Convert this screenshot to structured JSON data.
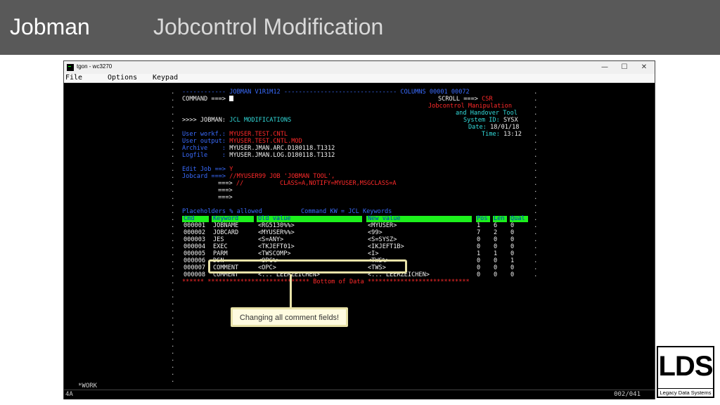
{
  "slide": {
    "title": "Jobman",
    "subtitle": "Jobcontrol Modification"
  },
  "window": {
    "title": "tgon - wc3270",
    "minimize": "—",
    "maximize": "☐",
    "close": "✕"
  },
  "menu": {
    "file": "File",
    "options": "Options",
    "keypad": "Keypad"
  },
  "terminal": {
    "line1_left": "------------ JOBMAN V1R1M12 ------------------------------- COLUMNS 00001 00072",
    "command_label": "COMMAND ===>",
    "scroll_label": "SCROLL ===>",
    "scroll_value": "CSR",
    "tagline1": "Jobcontrol Manipulation",
    "tagline2": "and Handover Tool",
    "system_label": "System ID:",
    "system_value": "SYSX",
    "prompt": ">>>> JOBMAN:",
    "prompt_title": "JCL MODIFICATIONS",
    "date_label": "Date:",
    "date_value": "18/01/18",
    "time_label": "Time:",
    "time_value": "13:12",
    "workf_label": "User workf.:",
    "workf_value": "MYUSER.TEST.CNTL",
    "output_label": "User output:",
    "output_value": "MYUSER.TEST.CNTL.MOD",
    "archive_label": "Archive    :",
    "archive_value": "MYUSER.JMAN.ARC.D180118.T1312",
    "logfile_label": "Logfile    :",
    "logfile_value": "MYUSER.JMAN.LOG.D180118.T1312",
    "editjob_label": "Edit Job ==>",
    "editjob_value": "Y",
    "jobcard_label": "Jobcard ===>",
    "jobcard_value1": "//MYUSER99 JOB 'JOBMAN TOOL',",
    "jobcard_cont": "===>",
    "jobcard_value2": "//          CLASS=A,NOTIFY=MYUSER,MSGCLASS=A",
    "jobcard_cont3": "===>",
    "jobcard_cont4": "===>",
    "placeholders": "Placeholders % allowed",
    "command_kw": "Command KW = JCL Keywords",
    "columns": {
      "cmd": "Cmd",
      "keyword": "Keyword",
      "old": "Old value",
      "new": "New value",
      "pos": "Pos",
      "len": "Len",
      "qual": "Qual"
    },
    "rows": [
      {
        "cmd": "000001",
        "keyword": "JOBNAME",
        "old": "<RG5130%%>",
        "new": "<MYUSER>",
        "pos": "1",
        "len": "6",
        "qual": "0"
      },
      {
        "cmd": "000002",
        "keyword": "JOBCARD",
        "old": "<MYUSER%%>",
        "new": "<99>",
        "pos": "7",
        "len": "2",
        "qual": "0"
      },
      {
        "cmd": "000003",
        "keyword": "JES",
        "old": "<S=ANY>",
        "new": "<S=SYSZ>",
        "pos": "0",
        "len": "0",
        "qual": "0"
      },
      {
        "cmd": "000004",
        "keyword": "EXEC",
        "old": "<TKJEFT01>",
        "new": "<IKJEFT1B>",
        "pos": "0",
        "len": "0",
        "qual": "0"
      },
      {
        "cmd": "000005",
        "keyword": "PARM",
        "old": "<TWSCOMP>",
        "new": "<I>",
        "pos": "1",
        "len": "1",
        "qual": "0"
      },
      {
        "cmd": "000006",
        "keyword": "DSN",
        "old": "<OPC%>",
        "new": "<TWS%>",
        "pos": "0",
        "len": "0",
        "qual": "1"
      },
      {
        "cmd": "000007",
        "keyword": "COMMENT",
        "old": "<OPC>",
        "new": "<TWS>",
        "pos": "0",
        "len": "0",
        "qual": "0"
      },
      {
        "cmd": "000008",
        "keyword": "COMMENT",
        "old": "<... LEERZEICHEN>",
        "new": "<... LEERZEICHEN>",
        "pos": "0",
        "len": "0",
        "qual": "0"
      }
    ],
    "bottom": "****** **************************** Bottom of Data ****************************"
  },
  "status": {
    "work": "*WORK",
    "left": "4A",
    "right": "002/041"
  },
  "callout": {
    "text": "Changing all comment fields!"
  },
  "logo": {
    "big": "LDS",
    "small": "Legacy Data Systems"
  },
  "colors": {
    "header_bg": "#595959",
    "terminal_bg": "#000000",
    "highlight": "#e8e2a8",
    "table_header": "#1cf01c"
  }
}
